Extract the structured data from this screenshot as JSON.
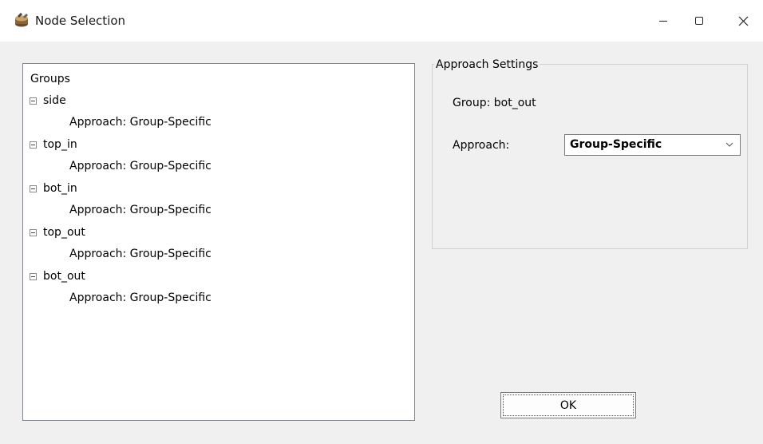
{
  "window": {
    "title": "Node Selection",
    "icon": "node-app-icon",
    "controls": {
      "minimize_icon": "minimize-icon",
      "maximize_icon": "maximize-icon",
      "close_icon": "close-icon"
    }
  },
  "tree": {
    "header": "Groups",
    "nodes": [
      {
        "label": "side",
        "child": "Approach: Group-Specific"
      },
      {
        "label": "top_in",
        "child": "Approach: Group-Specific"
      },
      {
        "label": "bot_in",
        "child": "Approach: Group-Specific"
      },
      {
        "label": "top_out",
        "child": "Approach: Group-Specific"
      },
      {
        "label": "bot_out",
        "child": "Approach: Group-Specific"
      }
    ]
  },
  "settings": {
    "legend": "Approach Settings",
    "group_text": "Group: bot_out",
    "approach_label": "Approach:",
    "approach_value": "Group-Specific"
  },
  "buttons": {
    "ok_label": "OK"
  }
}
